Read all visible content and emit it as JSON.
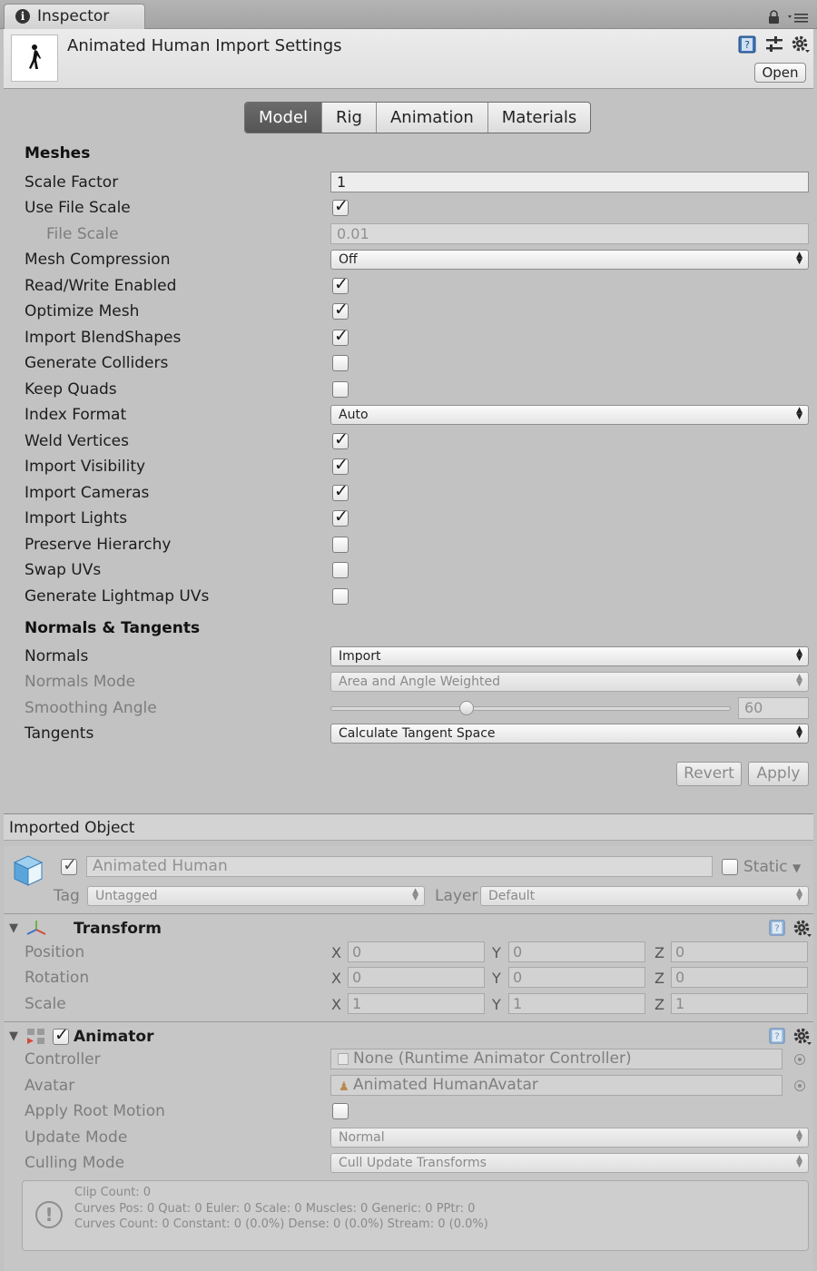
{
  "window": {
    "tab_title": "Inspector"
  },
  "header": {
    "title": "Animated Human Import Settings",
    "open_label": "Open"
  },
  "tabs": [
    {
      "label": "Model",
      "active": true
    },
    {
      "label": "Rig",
      "active": false
    },
    {
      "label": "Animation",
      "active": false
    },
    {
      "label": "Materials",
      "active": false
    }
  ],
  "meshes": {
    "section_title": "Meshes",
    "scale_factor": {
      "label": "Scale Factor",
      "value": "1"
    },
    "use_file_scale": {
      "label": "Use File Scale",
      "checked": true
    },
    "file_scale": {
      "label": "File Scale",
      "value": "0.01"
    },
    "mesh_compression": {
      "label": "Mesh Compression",
      "value": "Off"
    },
    "read_write": {
      "label": "Read/Write Enabled",
      "checked": true
    },
    "optimize_mesh": {
      "label": "Optimize Mesh",
      "checked": true
    },
    "import_blendshapes": {
      "label": "Import BlendShapes",
      "checked": true
    },
    "generate_colliders": {
      "label": "Generate Colliders",
      "checked": false
    },
    "keep_quads": {
      "label": "Keep Quads",
      "checked": false
    },
    "index_format": {
      "label": "Index Format",
      "value": "Auto"
    },
    "weld_vertices": {
      "label": "Weld Vertices",
      "checked": true
    },
    "import_visibility": {
      "label": "Import Visibility",
      "checked": true
    },
    "import_cameras": {
      "label": "Import Cameras",
      "checked": true
    },
    "import_lights": {
      "label": "Import Lights",
      "checked": true
    },
    "preserve_hierarchy": {
      "label": "Preserve Hierarchy",
      "checked": false
    },
    "swap_uvs": {
      "label": "Swap UVs",
      "checked": false
    },
    "generate_lightmap_uvs": {
      "label": "Generate Lightmap UVs",
      "checked": false
    }
  },
  "normals": {
    "section_title": "Normals & Tangents",
    "normals": {
      "label": "Normals",
      "value": "Import"
    },
    "normals_mode": {
      "label": "Normals Mode",
      "value": "Area and Angle Weighted"
    },
    "smoothing_angle": {
      "label": "Smoothing Angle",
      "value": "60",
      "min": 0,
      "max": 180
    },
    "tangents": {
      "label": "Tangents",
      "value": "Calculate Tangent Space"
    }
  },
  "actions": {
    "revert": "Revert",
    "apply": "Apply"
  },
  "imported_object": {
    "bar_title": "Imported Object",
    "name": "Animated Human",
    "active": true,
    "static_label": "Static",
    "static_checked": false,
    "tag_label": "Tag",
    "tag_value": "Untagged",
    "layer_label": "Layer",
    "layer_value": "Default"
  },
  "transform": {
    "title": "Transform",
    "axes": [
      "X",
      "Y",
      "Z"
    ],
    "position": {
      "label": "Position",
      "values": [
        "0",
        "0",
        "0"
      ]
    },
    "rotation": {
      "label": "Rotation",
      "values": [
        "0",
        "0",
        "0"
      ]
    },
    "scale": {
      "label": "Scale",
      "values": [
        "1",
        "1",
        "1"
      ]
    }
  },
  "animator": {
    "title": "Animator",
    "enabled": true,
    "controller": {
      "label": "Controller",
      "value": "None (Runtime Animator Controller)"
    },
    "avatar": {
      "label": "Avatar",
      "value": "Animated HumanAvatar"
    },
    "apply_root_motion": {
      "label": "Apply Root Motion",
      "checked": false
    },
    "update_mode": {
      "label": "Update Mode",
      "value": "Normal"
    },
    "culling_mode": {
      "label": "Culling Mode",
      "value": "Cull Update Transforms"
    },
    "info_lines": [
      "Clip Count: 0",
      "Curves Pos: 0 Quat: 0 Euler: 0 Scale: 0 Muscles: 0 Generic: 0 PPtr: 0",
      "Curves Count: 0 Constant: 0 (0.0%) Dense: 0 (0.0%) Stream: 0 (0.0%)"
    ]
  }
}
